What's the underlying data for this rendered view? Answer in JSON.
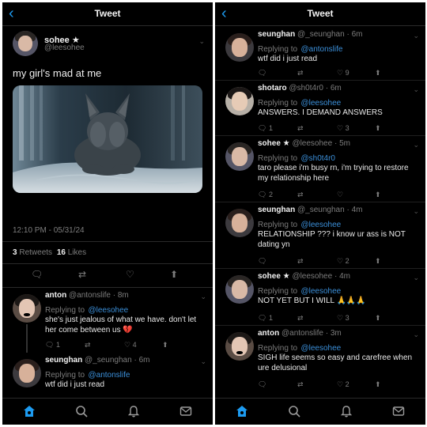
{
  "left": {
    "header": {
      "title": "Tweet"
    },
    "main": {
      "name": "sohee ★",
      "handle": "@leesohee",
      "text": "my girl's mad at me",
      "timestamp": "12:10 PM - 05/31/24",
      "retweets_count": "3",
      "retweets_label": "Retweets",
      "likes_count": "16",
      "likes_label": "Likes"
    },
    "replies": [
      {
        "name": "anton",
        "handle": "@antonslife",
        "time": "8m",
        "replying_label": "Replying to",
        "replying_to": "@leesohee",
        "text": "she's just jealous of what we have. don't let her come between us 💔",
        "actions": {
          "reply": "1",
          "retweet": "",
          "like": "4"
        }
      },
      {
        "name": "seunghan",
        "handle": "@_seunghan",
        "time": "6m",
        "replying_label": "Replying to",
        "replying_to": "@antonslife",
        "text": "wtf did i just read"
      }
    ]
  },
  "right": {
    "header": {
      "title": "Tweet"
    },
    "replies": [
      {
        "name": "seunghan",
        "handle": "@_seunghan",
        "time": "6m",
        "replying_label": "Replying to",
        "replying_to": "@antonslife",
        "text": "wtf did i just read",
        "actions": {
          "reply": "",
          "retweet": "",
          "like": "9"
        }
      },
      {
        "name": "shotaro",
        "handle": "@sh0t4r0",
        "time": "6m",
        "replying_label": "Replying to",
        "replying_to": "@leesohee",
        "text": "ANSWERS. I DEMAND ANSWERS",
        "actions": {
          "reply": "1",
          "retweet": "",
          "like": "3"
        }
      },
      {
        "name": "sohee ★",
        "handle": "@leesohee",
        "time": "5m",
        "replying_label": "Replying to",
        "replying_to": "@sh0t4r0",
        "text": "taro please i'm busy rn, i'm trying to restore my relationship here",
        "actions": {
          "reply": "2",
          "retweet": "",
          "like": ""
        }
      },
      {
        "name": "seunghan",
        "handle": "@_seunghan",
        "time": "4m",
        "replying_label": "Replying to",
        "replying_to": "@leesohee",
        "text": "RELATIONSHIP ??? i know ur ass is NOT dating yn",
        "actions": {
          "reply": "",
          "retweet": "",
          "like": "2"
        }
      },
      {
        "name": "sohee ★",
        "handle": "@leesohee",
        "time": "4m",
        "replying_label": "Replying to",
        "replying_to": "@leesohee",
        "text": "NOT YET BUT I WILL 🙏🙏🙏",
        "actions": {
          "reply": "1",
          "retweet": "",
          "like": "3"
        }
      },
      {
        "name": "anton",
        "handle": "@antonslife",
        "time": "3m",
        "replying_label": "Replying to",
        "replying_to": "@leesohee",
        "text": "SIGH life seems so easy and carefree when ure delusional",
        "actions": {
          "reply": "",
          "retweet": "",
          "like": "2"
        }
      }
    ]
  },
  "icons": {
    "back": "chevron-left-icon",
    "home": "home-icon",
    "search": "search-icon",
    "notifications": "bell-icon",
    "messages": "mail-icon"
  },
  "colors": {
    "accent": "#1d9bf0",
    "background": "#000000",
    "mention": "#3b8fd9",
    "secondary": "#7c7c7c"
  }
}
